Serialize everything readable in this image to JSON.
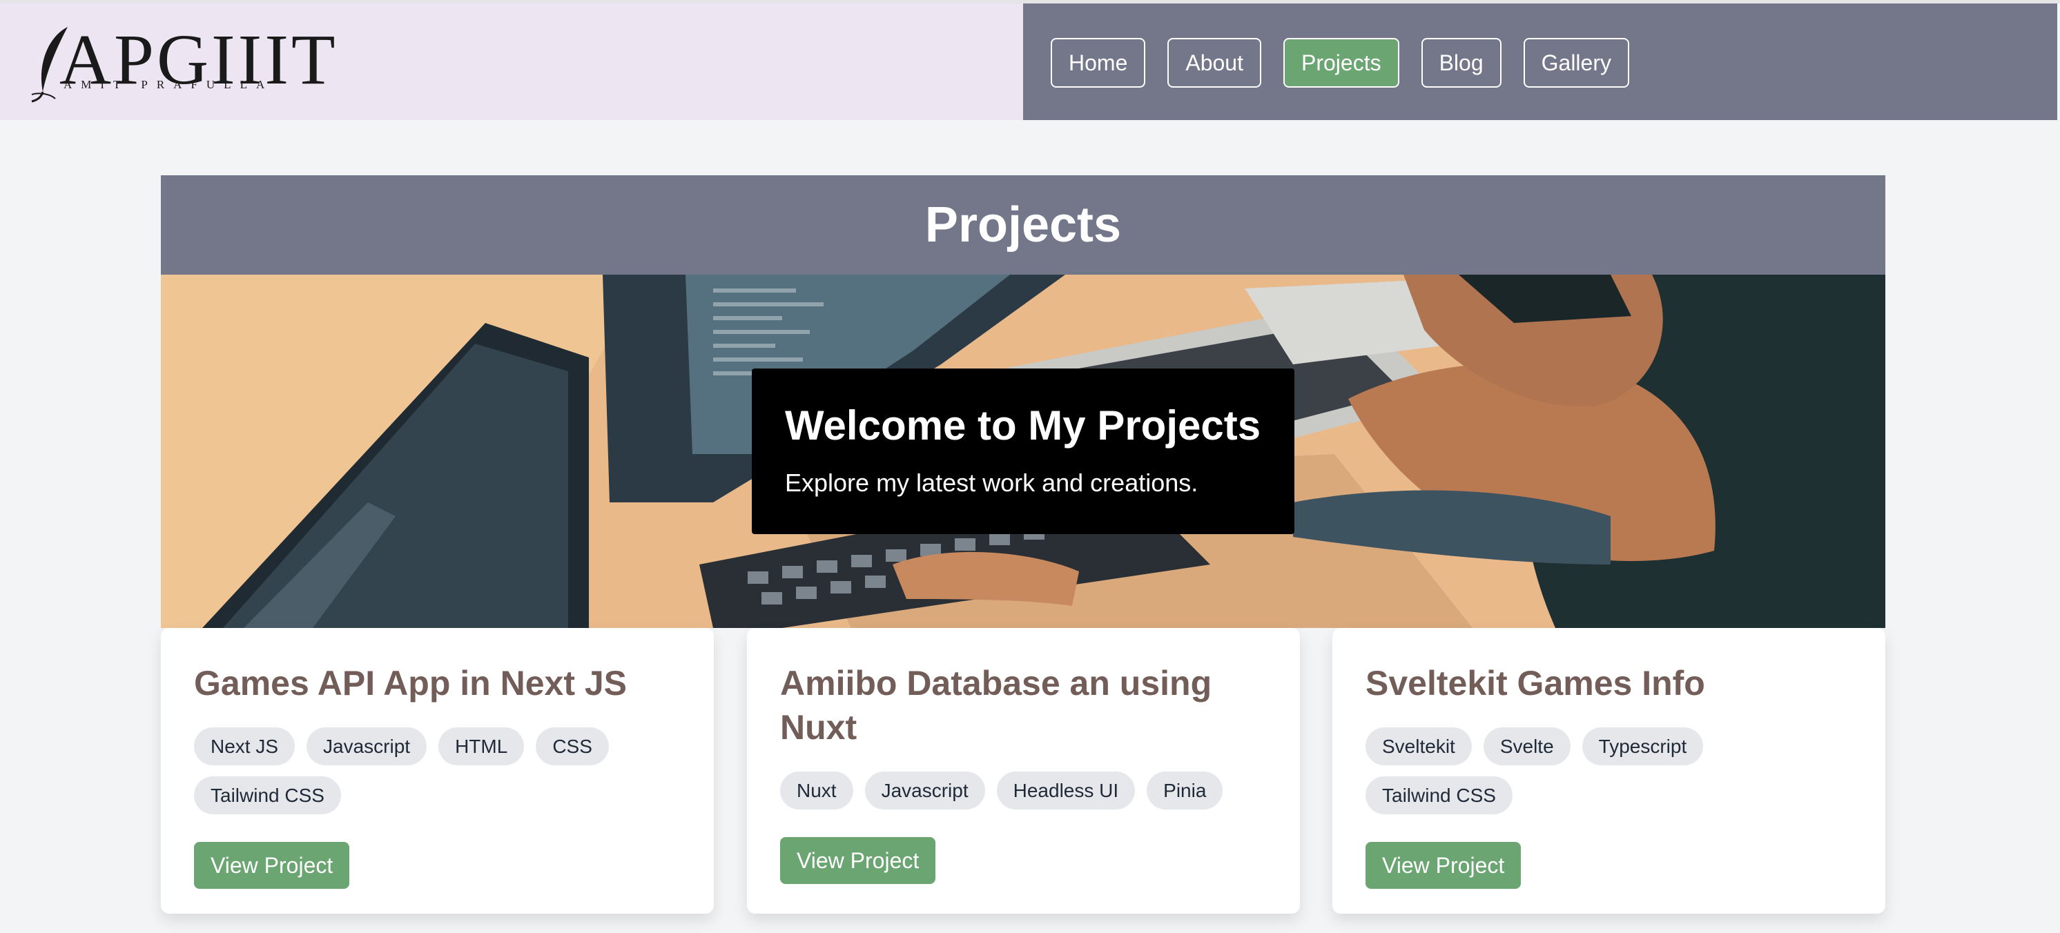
{
  "brand": {
    "logo_text": "APGIIIT",
    "logo_subtitle": "AMIT PRAFULLA"
  },
  "nav": {
    "items": [
      {
        "label": "Home",
        "active": false
      },
      {
        "label": "About",
        "active": false
      },
      {
        "label": "Projects",
        "active": true
      },
      {
        "label": "Blog",
        "active": false
      },
      {
        "label": "Gallery",
        "active": false
      }
    ]
  },
  "projects_section": {
    "title": "Projects",
    "hero": {
      "title": "Welcome to My Projects",
      "subtitle": "Explore my latest work and creations."
    }
  },
  "cards": [
    {
      "title": "Games API App in Next JS",
      "tags": [
        "Next JS",
        "Javascript",
        "HTML",
        "CSS",
        "Tailwind CSS"
      ],
      "button": "View Project"
    },
    {
      "title": "Amiibo Database an using Nuxt",
      "tags": [
        "Nuxt",
        "Javascript",
        "Headless UI",
        "Pinia"
      ],
      "button": "View Project"
    },
    {
      "title": "Sveltekit Games Info",
      "tags": [
        "Sveltekit",
        "Svelte",
        "Typescript",
        "Tailwind CSS"
      ],
      "button": "View Project"
    }
  ],
  "colors": {
    "header_left_bg": "#ede6f2",
    "header_right_bg": "#737789",
    "accent_green": "#6aa572",
    "card_title": "#735d58",
    "page_bg": "#f3f4f6"
  }
}
